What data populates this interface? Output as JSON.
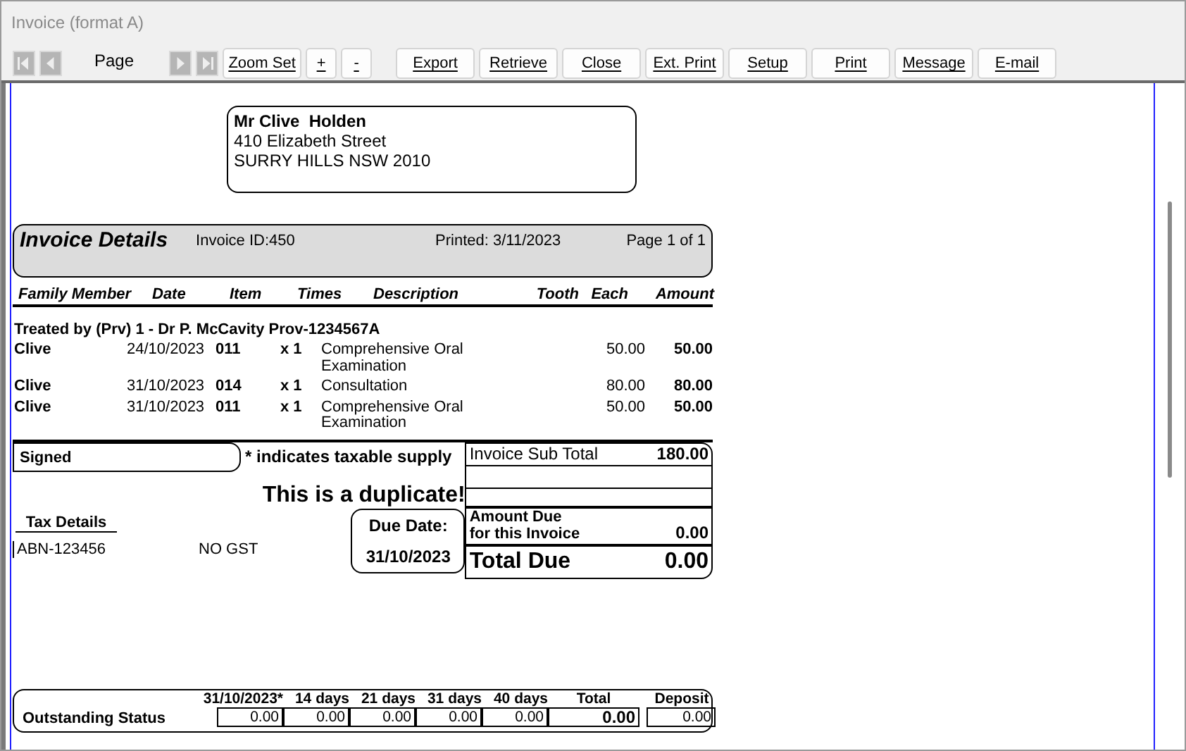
{
  "window": {
    "title": "Invoice (format A)"
  },
  "toolbar": {
    "nav_buttons": [
      {
        "kind": "first"
      },
      {
        "kind": "prev"
      }
    ],
    "page_label": "Page",
    "nav_buttons_after": [
      {
        "kind": "next"
      },
      {
        "kind": "last"
      }
    ],
    "buttons": [
      {
        "label": "Zoom Set"
      },
      {
        "label": "+"
      },
      {
        "label": "-"
      },
      {
        "label": "Export"
      },
      {
        "label": "Retrieve"
      },
      {
        "label": "Close"
      },
      {
        "label": "Ext. Print"
      },
      {
        "label": "Setup"
      },
      {
        "label": "Print"
      },
      {
        "label": "Message"
      },
      {
        "label": "E-mail"
      }
    ]
  },
  "address": {
    "name": "Mr Clive  Holden",
    "lines": [
      "410 Elizabeth Street",
      "SURRY HILLS NSW 2010"
    ]
  },
  "details": {
    "title": "Invoice Details",
    "invoice_id": "Invoice ID:450",
    "printed": "Printed: 3/11/2023",
    "page": "Page 1 of 1"
  },
  "table": {
    "columns": [
      "Family Member",
      "Date",
      "Item",
      "Times",
      "Description",
      "Tooth",
      "Each",
      "Amount"
    ],
    "group": "Treated by (Prv) 1 - Dr P. McCavity Prov-1234567A",
    "rows": [
      {
        "member": "Clive",
        "date": "24/10/2023",
        "item": "011",
        "times": "x 1",
        "description": "Comprehensive Oral Examination",
        "tooth": "",
        "each": "50.00",
        "amount": "50.00"
      },
      {
        "member": "Clive",
        "date": "31/10/2023",
        "item": "014",
        "times": "x 1",
        "description": "Consultation",
        "tooth": "",
        "each": "80.00",
        "amount": "80.00"
      },
      {
        "member": "Clive",
        "date": "31/10/2023",
        "item": "011",
        "times": "x 1",
        "description": "Comprehensive Oral Examination",
        "tooth": "",
        "each": "50.00",
        "amount": "50.00"
      }
    ]
  },
  "signed": "Signed",
  "taxable_note": "* indicates taxable supply",
  "duplicate": "This is a duplicate!",
  "tax": {
    "title": "Tax Details",
    "abn": "ABN-123456",
    "gst": "NO GST"
  },
  "due": {
    "label": "Due Date:",
    "date": "31/10/2023"
  },
  "totals": {
    "sub_total_label": "Invoice Sub Total",
    "sub_total": "180.00",
    "amount_due_label": "Amount Due",
    "amount_due_label_2": "for this Invoice",
    "amount_due": "0.00",
    "total_due_label": "Total Due",
    "total_due": "0.00"
  },
  "outstanding": {
    "label": "Outstanding Status",
    "columns": [
      {
        "heading": "31/10/2023*",
        "value": "0.00",
        "kind": "period"
      },
      {
        "heading": "14 days",
        "value": "0.00",
        "kind": "period"
      },
      {
        "heading": "21 days",
        "value": "0.00",
        "kind": "period"
      },
      {
        "heading": "31 days",
        "value": "0.00",
        "kind": "period"
      },
      {
        "heading": "40 days",
        "value": "0.00",
        "kind": "period"
      },
      {
        "heading": "Total",
        "value": "0.00",
        "kind": "total"
      },
      {
        "heading": "Deposit",
        "value": "0.00",
        "kind": "deposit"
      }
    ]
  }
}
